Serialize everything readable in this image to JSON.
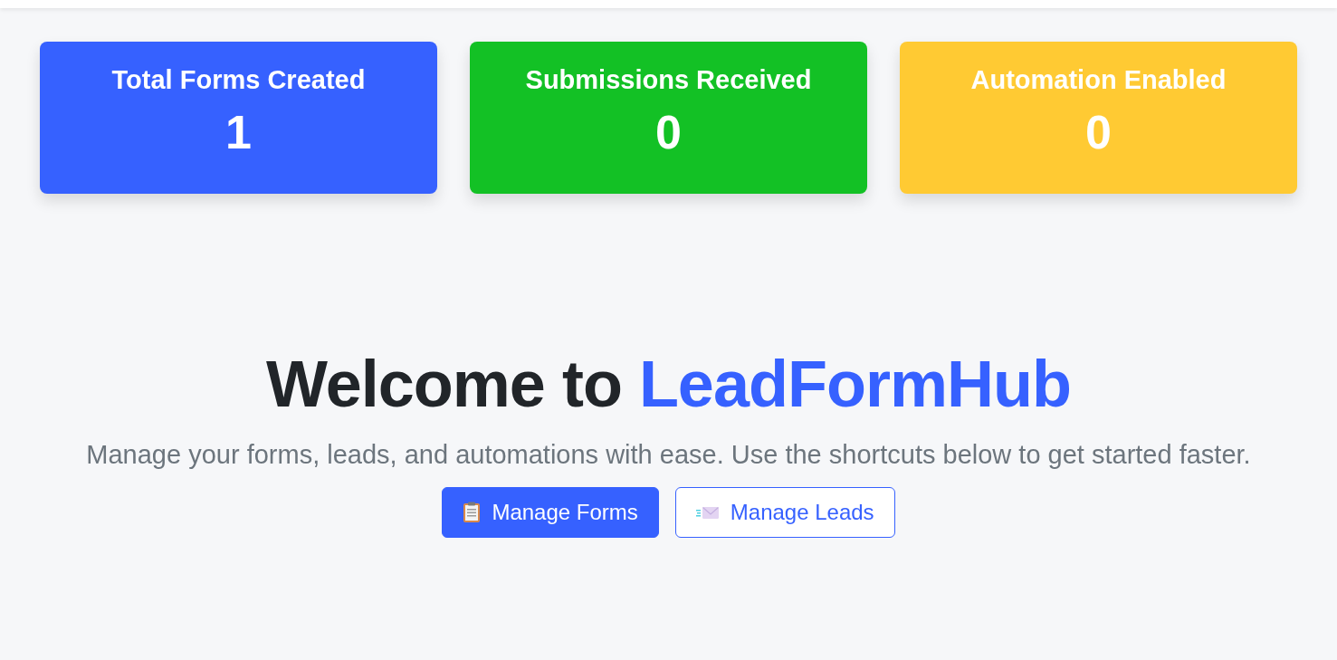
{
  "stats": [
    {
      "title": "Total Forms Created",
      "value": "1",
      "color": "#3661ff"
    },
    {
      "title": "Submissions Received",
      "value": "0",
      "color": "#13c125"
    },
    {
      "title": "Automation Enabled",
      "value": "0",
      "color": "#ffca33"
    }
  ],
  "welcome": {
    "heading_prefix": "Welcome to",
    "brand": "LeadFormHub",
    "subtitle": "Manage your forms, leads, and automations with ease. Use the shortcuts below to get started faster."
  },
  "buttons": [
    {
      "label": "Manage Forms",
      "kind": "primary"
    },
    {
      "label": "Manage Leads",
      "kind": "outline"
    }
  ]
}
